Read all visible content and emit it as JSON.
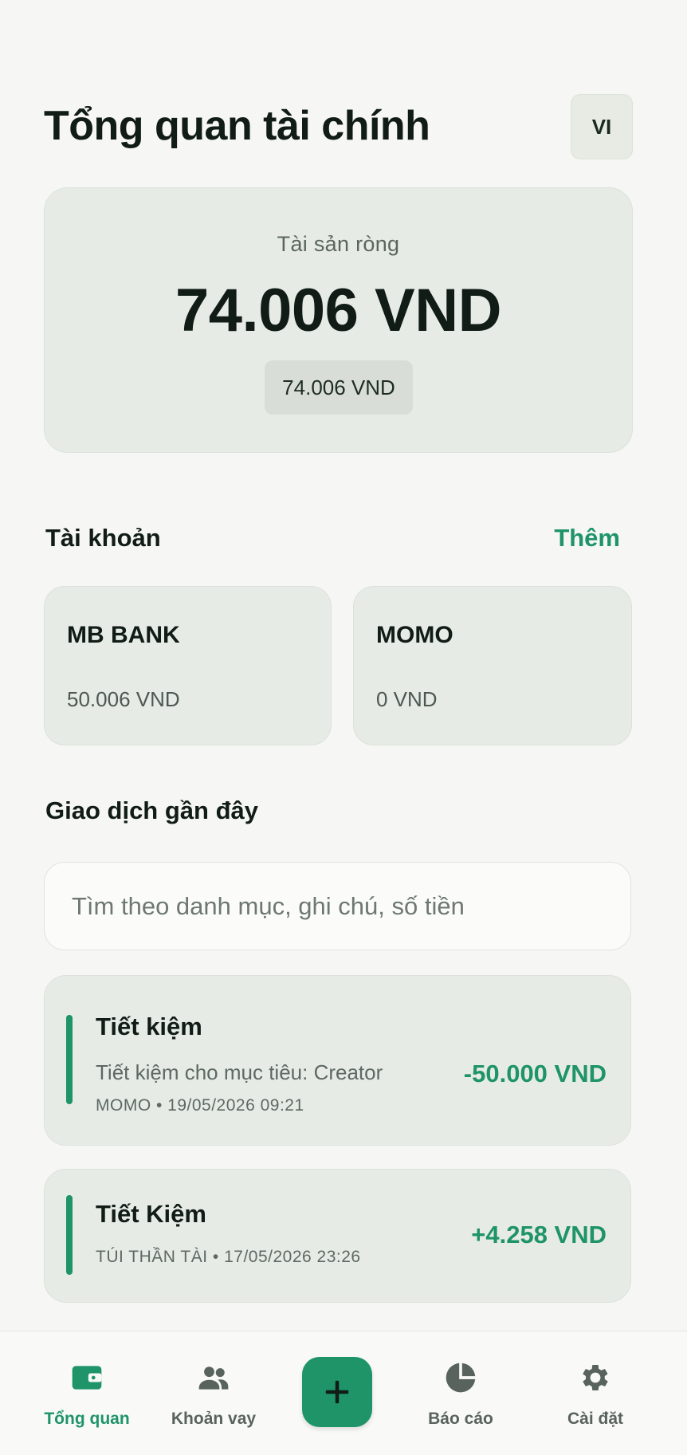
{
  "header": {
    "title": "Tổng quan tài chính",
    "language": "VI"
  },
  "net_worth": {
    "label": "Tài sản ròng",
    "amount": "74.006 VND",
    "secondary": "74.006 VND"
  },
  "accounts": {
    "title": "Tài khoản",
    "add_label": "Thêm",
    "items": [
      {
        "name": "MB BANK",
        "balance": "50.006 VND"
      },
      {
        "name": "MOMO",
        "balance": "0 VND"
      }
    ]
  },
  "transactions": {
    "title": "Giao dịch gần đây",
    "search_placeholder": "Tìm theo danh mục, ghi chú, số tiền",
    "items": [
      {
        "category": "Tiết kiệm",
        "note": "Tiết kiệm cho mục tiêu: Creator",
        "meta": "MOMO • 19/05/2026 09:21",
        "amount": "-50.000 VND"
      },
      {
        "category": "Tiết Kiệm",
        "meta": "TÚI THẦN TÀI • 17/05/2026 23:26",
        "amount": "+4.258 VND"
      }
    ]
  },
  "nav": {
    "items": [
      {
        "label": "Tổng quan",
        "icon": "wallet-icon",
        "active": true
      },
      {
        "label": "Khoản vay",
        "icon": "people-icon",
        "active": false
      },
      {
        "label": "Báo cáo",
        "icon": "pie-chart-icon",
        "active": false
      },
      {
        "label": "Cài đặt",
        "icon": "gear-icon",
        "active": false
      }
    ],
    "add_icon": "plus-icon"
  },
  "colors": {
    "accent": "#1e9468",
    "background": "#f6f7f4",
    "card": "#e7ebe5",
    "text": "#111c16",
    "muted": "#5e6963"
  }
}
